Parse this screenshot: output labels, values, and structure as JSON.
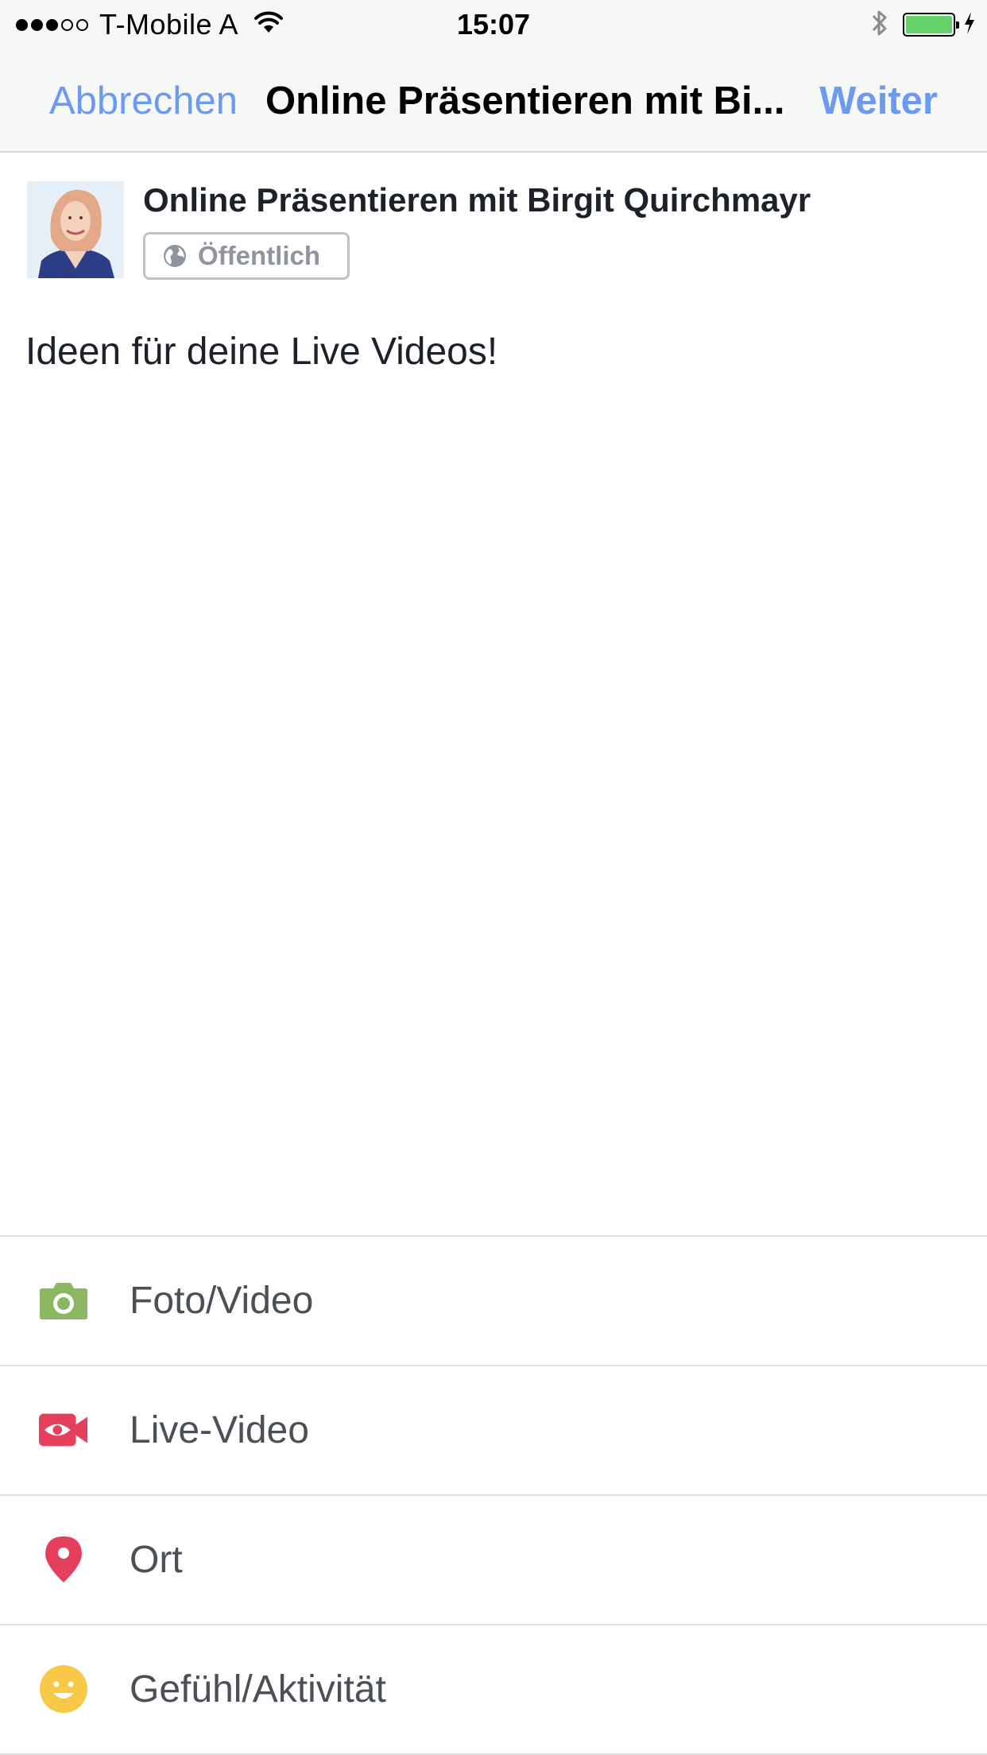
{
  "status_bar": {
    "signal_on": 3,
    "signal_off": 2,
    "carrier": "T-Mobile A",
    "time": "15:07",
    "battery_level": 1.0,
    "battery_color": "#65d269"
  },
  "nav": {
    "cancel_label": "Abbrechen",
    "title": "Online Präsentieren mit Bi...",
    "next_label": "Weiter",
    "accent_color": "#6c9af0"
  },
  "author": {
    "name": "Online Präsentieren mit Birgit Quirchmayr",
    "privacy_label": "Öffentlich",
    "privacy_icon": "globe-icon"
  },
  "post": {
    "text": "Ideen für deine Live Videos!"
  },
  "actions": [
    {
      "label": "Foto/Video",
      "icon": "camera-icon",
      "color": "#8bb662"
    },
    {
      "label": "Live-Video",
      "icon": "video-camera-icon",
      "color": "#e63f5d"
    },
    {
      "label": "Ort",
      "icon": "location-pin-icon",
      "color": "#e63f5d"
    },
    {
      "label": "Gefühl/Aktivität",
      "icon": "smiley-icon",
      "color": "#f7c946"
    }
  ]
}
